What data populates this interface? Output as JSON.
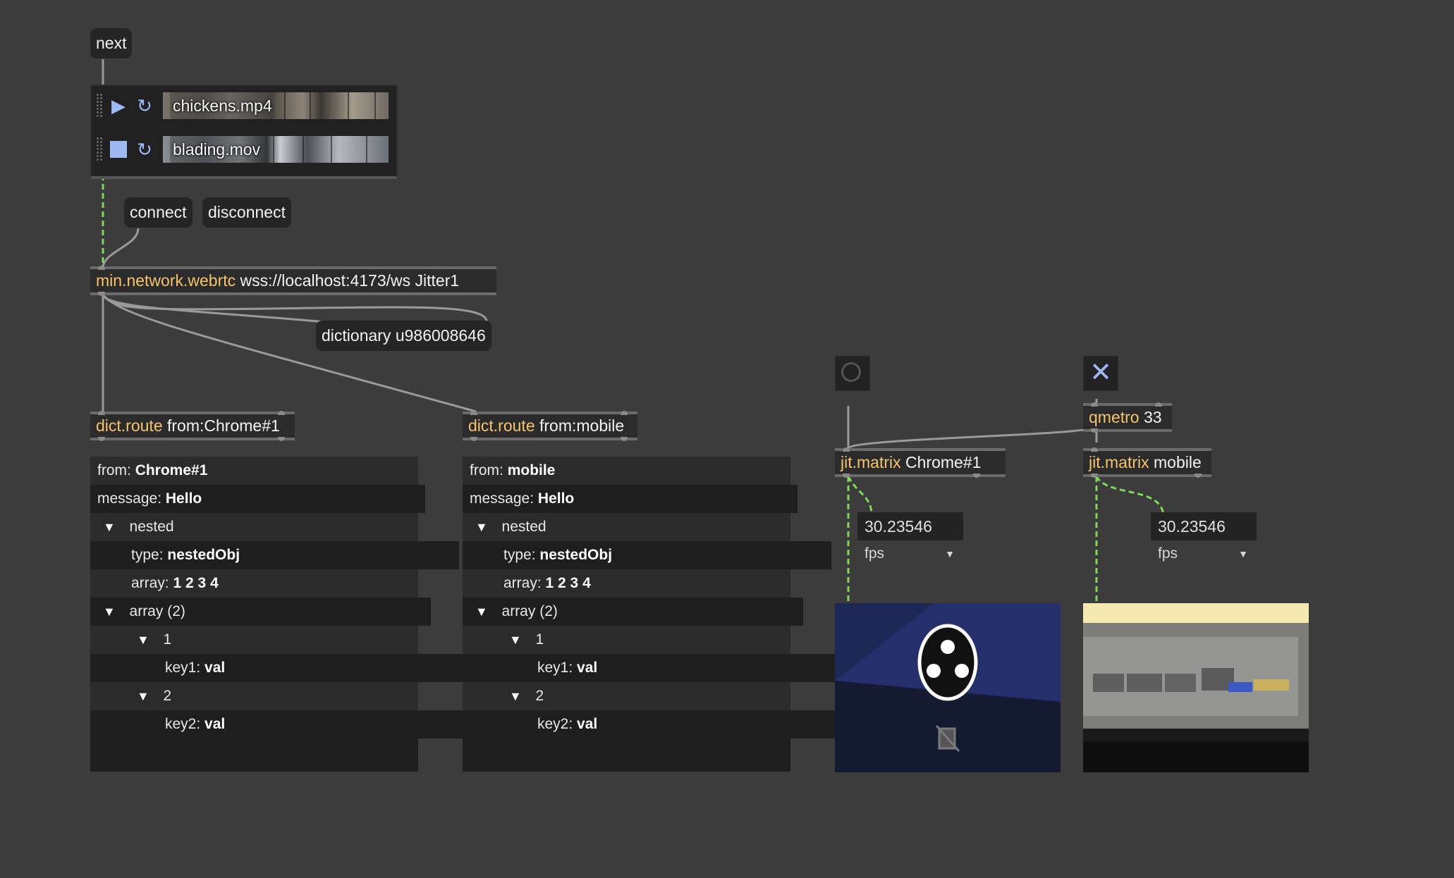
{
  "messages": {
    "next": "next",
    "connect": "connect",
    "disconnect": "disconnect",
    "dictionary": "dictionary u986008646"
  },
  "playlist": {
    "items": [
      {
        "name": "chickens.mp4",
        "state": "play-icon"
      },
      {
        "name": "blading.mov",
        "state": "stop-icon"
      }
    ]
  },
  "objects": {
    "webrtc": {
      "cls": "min.network.webrtc",
      "args": "wss://localhost:4173/ws Jitter1"
    },
    "route_chrome": {
      "cls": "dict.route",
      "args": "from:Chrome#1"
    },
    "route_mobile": {
      "cls": "dict.route",
      "args": "from:mobile"
    },
    "qmetro": {
      "cls": "qmetro",
      "args": "33"
    },
    "matrix_chrome": {
      "cls": "jit.matrix",
      "args": "Chrome#1"
    },
    "matrix_mobile": {
      "cls": "jit.matrix",
      "args": "mobile"
    }
  },
  "dict_chrome": {
    "from_key": "from:",
    "from_val": "Chrome#1",
    "message_key": "message:",
    "message_val": "Hello",
    "nested": "nested",
    "type_key": "type:",
    "type_val": "nestedObj",
    "array_key": "array:",
    "array_val": "1 2 3 4",
    "array2": "array (2)",
    "i1": "1",
    "key1": "key1:",
    "val1": "val",
    "i2": "2",
    "key2": "key2:",
    "val2": "val"
  },
  "dict_mobile": {
    "from_key": "from:",
    "from_val": "mobile",
    "message_key": "message:",
    "message_val": "Hello",
    "nested": "nested",
    "type_key": "type:",
    "type_val": "nestedObj",
    "array_key": "array:",
    "array_val": "1 2 3 4",
    "array2": "array (2)",
    "i1": "1",
    "key1": "key1:",
    "val1": "val",
    "i2": "2",
    "key2": "key2:",
    "val2": "val"
  },
  "fps_chrome": {
    "value": "30.23546",
    "unit": "fps"
  },
  "fps_mobile": {
    "value": "30.23546",
    "unit": "fps"
  },
  "colors": {
    "background": "#3c3c3c",
    "object_class": "#f5c46b",
    "accent": "#9fb9f5",
    "matrix_cord": "#7ed957"
  }
}
